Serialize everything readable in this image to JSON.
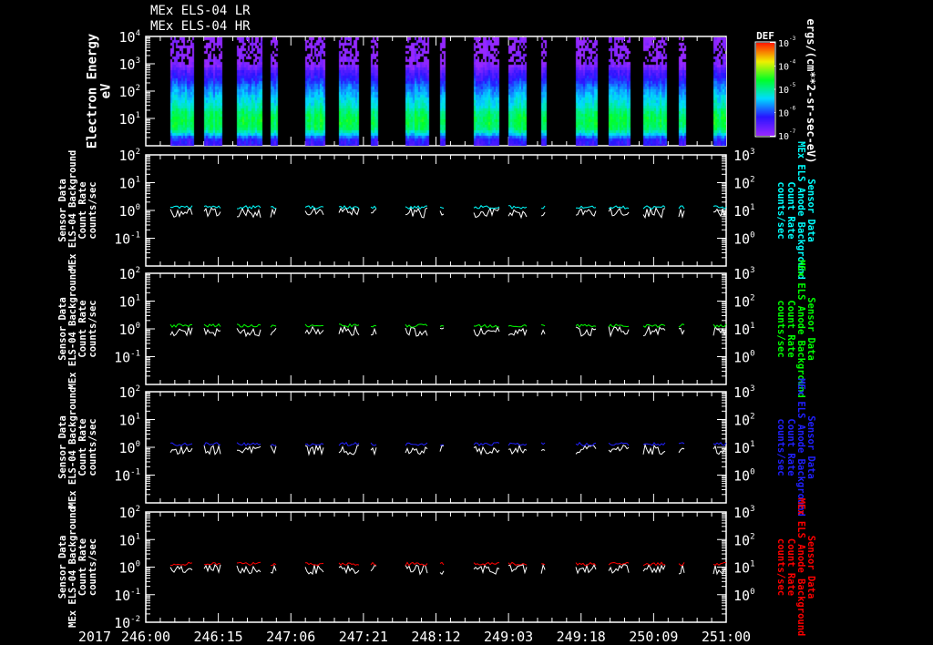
{
  "titles": [
    "MEx ELS-04 LR",
    "MEx ELS-04 HR"
  ],
  "colors": {
    "background": "#000000",
    "axes": "#ffffff",
    "panel_series": [
      "#00ffff",
      "#00ff00",
      "#2020ff",
      "#ff0000"
    ],
    "reference_series": "#ffffff"
  },
  "chart_data": [
    {
      "type": "heatmap",
      "title": "MEx ELS-04 LR / MEx ELS-04 HR",
      "ylabel": "Electron Energy",
      "yunit": "eV",
      "yscale": "log",
      "ylim": [
        1,
        10000
      ],
      "yticks": [
        1,
        10,
        100,
        1000,
        10000
      ],
      "colorbar": {
        "label": "DEF",
        "unit": "ergs/(cm**2-sr-sec-eV)",
        "scale": "log",
        "range": [
          1e-07,
          0.001
        ],
        "ticks": [
          -7,
          -6,
          -5,
          -4,
          -3
        ],
        "colormap": "rainbow (violet low, red high)"
      },
      "energy_profile_log10_eV": [
        0,
        0.3,
        0.5,
        0.7,
        1.0,
        1.3,
        1.5,
        1.8,
        2.0,
        2.3,
        2.5,
        2.8,
        3.0,
        3.5,
        4.0
      ],
      "energy_profile_log10_DEF": [
        -6.4,
        -6.2,
        -5.3,
        -4.8,
        -4.7,
        -4.9,
        -5.2,
        -5.4,
        -5.6,
        -5.9,
        -6.2,
        -6.5,
        -6.9,
        -7.0,
        -7.0
      ]
    },
    {
      "type": "line",
      "ylabel_left": [
        "Sensor Data",
        "MEx ELS-04 Background",
        "Count Rate",
        "counts/sec"
      ],
      "ylabel_right": [
        "Sensor Data",
        "MEx ELS Anode Background",
        "Count Rate",
        "counts/sec"
      ],
      "yscale": "log",
      "ylim_left": [
        0.01,
        100
      ],
      "ylim_right": [
        0.1,
        1000
      ],
      "series_levels": {
        "colored": 1.3,
        "white": 0.7
      }
    },
    {
      "type": "line",
      "ylabel_left": [
        "Sensor Data",
        "MEx ELS-04 Background",
        "Count Rate",
        "counts/sec"
      ],
      "ylabel_right": [
        "Sensor Data",
        "MEx ELS Anode Background",
        "Count Rate",
        "counts/sec"
      ],
      "yscale": "log",
      "ylim_left": [
        0.01,
        100
      ],
      "ylim_right": [
        0.1,
        1000
      ],
      "series_levels": {
        "colored": 1.3,
        "white": 0.7
      }
    },
    {
      "type": "line",
      "ylabel_left": [
        "Sensor Data",
        "MEx ELS-04 Background",
        "Count Rate",
        "counts/sec"
      ],
      "ylabel_right": [
        "Sensor Data",
        "MEx ELS Anode Background",
        "Count Rate",
        "counts/sec"
      ],
      "yscale": "log",
      "ylim_left": [
        0.01,
        100
      ],
      "ylim_right": [
        0.1,
        1000
      ],
      "series_levels": {
        "colored": 1.3,
        "white": 0.7
      }
    },
    {
      "type": "line",
      "ylabel_left": [
        "Sensor Data",
        "MEx ELS-04 Background",
        "Count Rate",
        "counts/sec"
      ],
      "ylabel_right": [
        "Sensor Data",
        "MEx ELS Anode Background",
        "Count Rate",
        "counts/sec"
      ],
      "yscale": "log",
      "ylim_left": [
        0.01,
        100
      ],
      "ylim_right": [
        0.1,
        1000
      ],
      "series_levels": {
        "colored": 1.3,
        "white": 0.7
      }
    }
  ],
  "x_axis": {
    "year": "2017",
    "range_doy": [
      246.0,
      251.0
    ],
    "tick_labels": [
      "246:00",
      "246:15",
      "247:06",
      "247:21",
      "248:12",
      "249:03",
      "249:18",
      "250:09",
      "251:00"
    ],
    "major_step_hours": 15,
    "minor_step_hours": 3
  },
  "data_intervals_doy": [
    [
      246.212,
      246.416
    ],
    [
      246.502,
      246.652
    ],
    [
      246.785,
      246.997
    ],
    [
      247.075,
      247.13
    ],
    [
      247.374,
      247.538
    ],
    [
      247.664,
      247.837
    ],
    [
      247.939,
      247.994
    ],
    [
      248.237,
      248.441
    ],
    [
      248.535,
      248.582
    ],
    [
      248.826,
      249.046
    ],
    [
      249.124,
      249.281
    ],
    [
      249.407,
      249.454
    ],
    [
      249.705,
      249.893
    ],
    [
      249.988,
      250.176
    ],
    [
      250.286,
      250.482
    ],
    [
      250.592,
      250.647
    ],
    [
      250.89,
      251.0
    ]
  ]
}
